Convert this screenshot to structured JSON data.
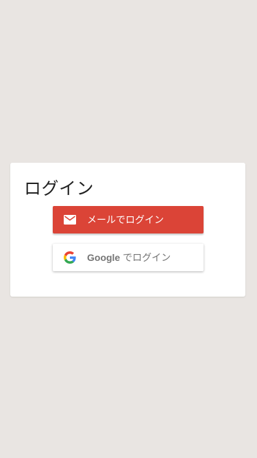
{
  "login": {
    "title": "ログイン",
    "email_button": {
      "label": "メールでログイン",
      "icon": "mail-icon",
      "background": "#db4437",
      "text_color": "#ffffff"
    },
    "google_button": {
      "brand": "Google",
      "label_suffix": " でログイン",
      "icon": "google-logo-icon",
      "background": "#ffffff",
      "text_color": "#757575"
    }
  },
  "colors": {
    "page_background": "#e9e5e2",
    "card_background": "#ffffff"
  }
}
